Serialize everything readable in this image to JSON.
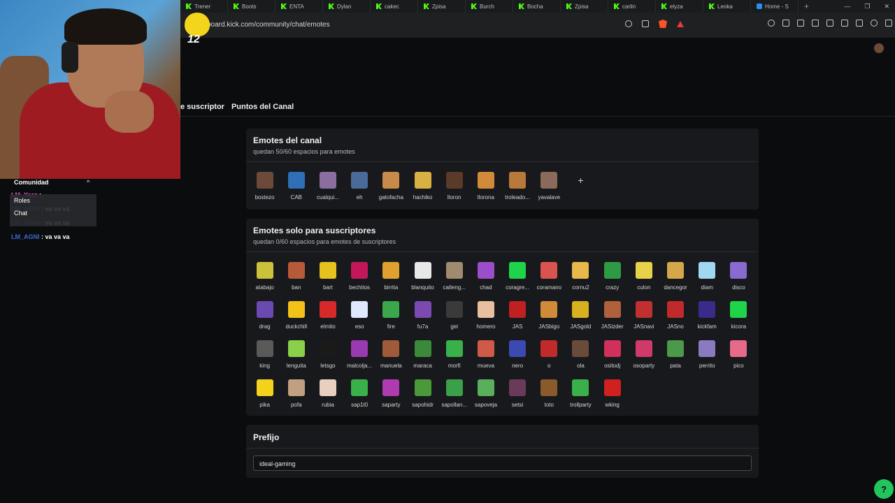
{
  "browser": {
    "tabs": [
      {
        "label": "Trener",
        "icon": "kick"
      },
      {
        "label": "Boots",
        "icon": "kick"
      },
      {
        "label": "ENTA",
        "icon": "kick"
      },
      {
        "label": "Dylan",
        "icon": "kick"
      },
      {
        "label": "cakec",
        "icon": "kick"
      },
      {
        "label": "Zpisa",
        "icon": "kick"
      },
      {
        "label": "Burch",
        "icon": "kick"
      },
      {
        "label": "Bocha",
        "icon": "kick"
      },
      {
        "label": "Zpisa",
        "icon": "kick"
      },
      {
        "label": "carlin",
        "icon": "kick"
      },
      {
        "label": "elyza",
        "icon": "kick"
      },
      {
        "label": "Leoka",
        "icon": "kick"
      },
      {
        "label": "Home - S",
        "icon": "home"
      }
    ],
    "new_tab": "+",
    "url": "board.kick.com/community/chat/emotes"
  },
  "subnav": {
    "tab_subscriptor": "e suscriptor",
    "tab_points": "Puntos del Canal"
  },
  "channel_emotes": {
    "title": "Emotes del canal",
    "subtitle": "quedan 50/60 espacios para emotes",
    "add_label": "+",
    "items": [
      {
        "label": "bostezo",
        "color": "#6b4a3a"
      },
      {
        "label": "CAB",
        "color": "#2f6fb5"
      },
      {
        "label": "cualqui...",
        "color": "#8a6f9e"
      },
      {
        "label": "eh",
        "color": "#4a6a9a"
      },
      {
        "label": "gatofacha",
        "color": "#c88a4a"
      },
      {
        "label": "hachiko",
        "color": "#d9b043"
      },
      {
        "label": "lloron",
        "color": "#5a3b2a"
      },
      {
        "label": "llorona",
        "color": "#d08a3a"
      },
      {
        "label": "troleado...",
        "color": "#b8793a"
      },
      {
        "label": "yavalave",
        "color": "#8a6a5a"
      }
    ]
  },
  "sub_emotes": {
    "title": "Emotes solo para suscriptores",
    "subtitle": "quedan 0/60 espacios para emotes de suscriptores",
    "items": [
      {
        "label": "atabajo",
        "color": "#c9c23a"
      },
      {
        "label": "ban",
        "color": "#b75a3a"
      },
      {
        "label": "bart",
        "color": "#e6c21f"
      },
      {
        "label": "bechitos",
        "color": "#c2185b"
      },
      {
        "label": "birrita",
        "color": "#e0a030"
      },
      {
        "label": "blanquito",
        "color": "#e8e8e8"
      },
      {
        "label": "catleng...",
        "color": "#a08a70"
      },
      {
        "label": "chad",
        "color": "#9b4dca"
      },
      {
        "label": "coragre...",
        "color": "#1fd34a"
      },
      {
        "label": "coramano",
        "color": "#d9534f"
      },
      {
        "label": "cornu2",
        "color": "#e8b84a"
      },
      {
        "label": "crazy",
        "color": "#2e9a44"
      },
      {
        "label": "culon",
        "color": "#e8d24a"
      },
      {
        "label": "dancegor",
        "color": "#d4a84a"
      },
      {
        "label": "diam",
        "color": "#9fd8f0"
      },
      {
        "label": "disco",
        "color": "#8a6ad0"
      },
      {
        "label": "drag",
        "color": "#6a4ab0"
      },
      {
        "label": "duckchill",
        "color": "#f2c21a"
      },
      {
        "label": "elmito",
        "color": "#d62a2a"
      },
      {
        "label": "eso",
        "color": "#dfe8ff"
      },
      {
        "label": "fire",
        "color": "#3aa84a"
      },
      {
        "label": "fu7a",
        "color": "#7a4ab0"
      },
      {
        "label": "gei",
        "color": "#3a3a3a"
      },
      {
        "label": "homero",
        "color": "#e8c0a0"
      },
      {
        "label": "JAS",
        "color": "#c02020"
      },
      {
        "label": "JASbigo",
        "color": "#d08a3a"
      },
      {
        "label": "JASgold",
        "color": "#d9b020"
      },
      {
        "label": "JASizder",
        "color": "#b0603a"
      },
      {
        "label": "JASnavi",
        "color": "#c03030"
      },
      {
        "label": "JASno",
        "color": "#c02a2a"
      },
      {
        "label": "kickfam",
        "color": "#3a2a8a"
      },
      {
        "label": "kicora",
        "color": "#1fd34a"
      },
      {
        "label": "king",
        "color": "#5a5a5a"
      },
      {
        "label": "lenguita",
        "color": "#8ad04a"
      },
      {
        "label": "letsgo",
        "color": "#1a1a1a"
      },
      {
        "label": "malcolja...",
        "color": "#9a3ab0"
      },
      {
        "label": "manuela",
        "color": "#a05a3a"
      },
      {
        "label": "maraca",
        "color": "#3a8a3a"
      },
      {
        "label": "morfi",
        "color": "#3ab04a"
      },
      {
        "label": "mueva",
        "color": "#d05a4a"
      },
      {
        "label": "nero",
        "color": "#3a4ab0"
      },
      {
        "label": "o",
        "color": "#c02a2a"
      },
      {
        "label": "ola",
        "color": "#6a4a3a"
      },
      {
        "label": "ositodj",
        "color": "#d0305a"
      },
      {
        "label": "osoparty",
        "color": "#d03a6a"
      },
      {
        "label": "pata",
        "color": "#4a9a4a"
      },
      {
        "label": "perrito",
        "color": "#8a7ac0"
      },
      {
        "label": "pico",
        "color": "#e86a8a"
      },
      {
        "label": "pika",
        "color": "#f2d21a"
      },
      {
        "label": "pofa",
        "color": "#c0a080"
      },
      {
        "label": "rubia",
        "color": "#e8d0c0"
      },
      {
        "label": "sap1t0",
        "color": "#3ab04a"
      },
      {
        "label": "saparty",
        "color": "#b03ab0"
      },
      {
        "label": "sapohidr",
        "color": "#4a9a3a"
      },
      {
        "label": "sapollan...",
        "color": "#3aa04a"
      },
      {
        "label": "sapoveja",
        "color": "#5ab05a"
      },
      {
        "label": "setsi",
        "color": "#6a3a5a"
      },
      {
        "label": "toto",
        "color": "#8a5a2a"
      },
      {
        "label": "trollparty",
        "color": "#3ab04a"
      },
      {
        "label": "wking",
        "color": "#d02020"
      }
    ]
  },
  "prefix": {
    "title": "Prefijo",
    "value": "ideal-gaming"
  },
  "overlay": {
    "sticker_text": "12",
    "chat_header": "Comunidad",
    "chat_lines": [
      {
        "user": "LM_Yazz",
        "text": " : ",
        "color": "#d45ad4"
      },
      {
        "user": "LM_AGNI",
        "text": " : va va vá",
        "color": "#3a6ad0"
      },
      {
        "user": "LM_AGNI",
        "text": " : va va va",
        "color": "#3a6ad0"
      },
      {
        "user": "LM_AGNI",
        "text": " : va va va",
        "color": "#3a6ad0"
      }
    ],
    "menu": [
      "Roles",
      "Chat"
    ],
    "chevron": "^"
  },
  "help_button": "?"
}
